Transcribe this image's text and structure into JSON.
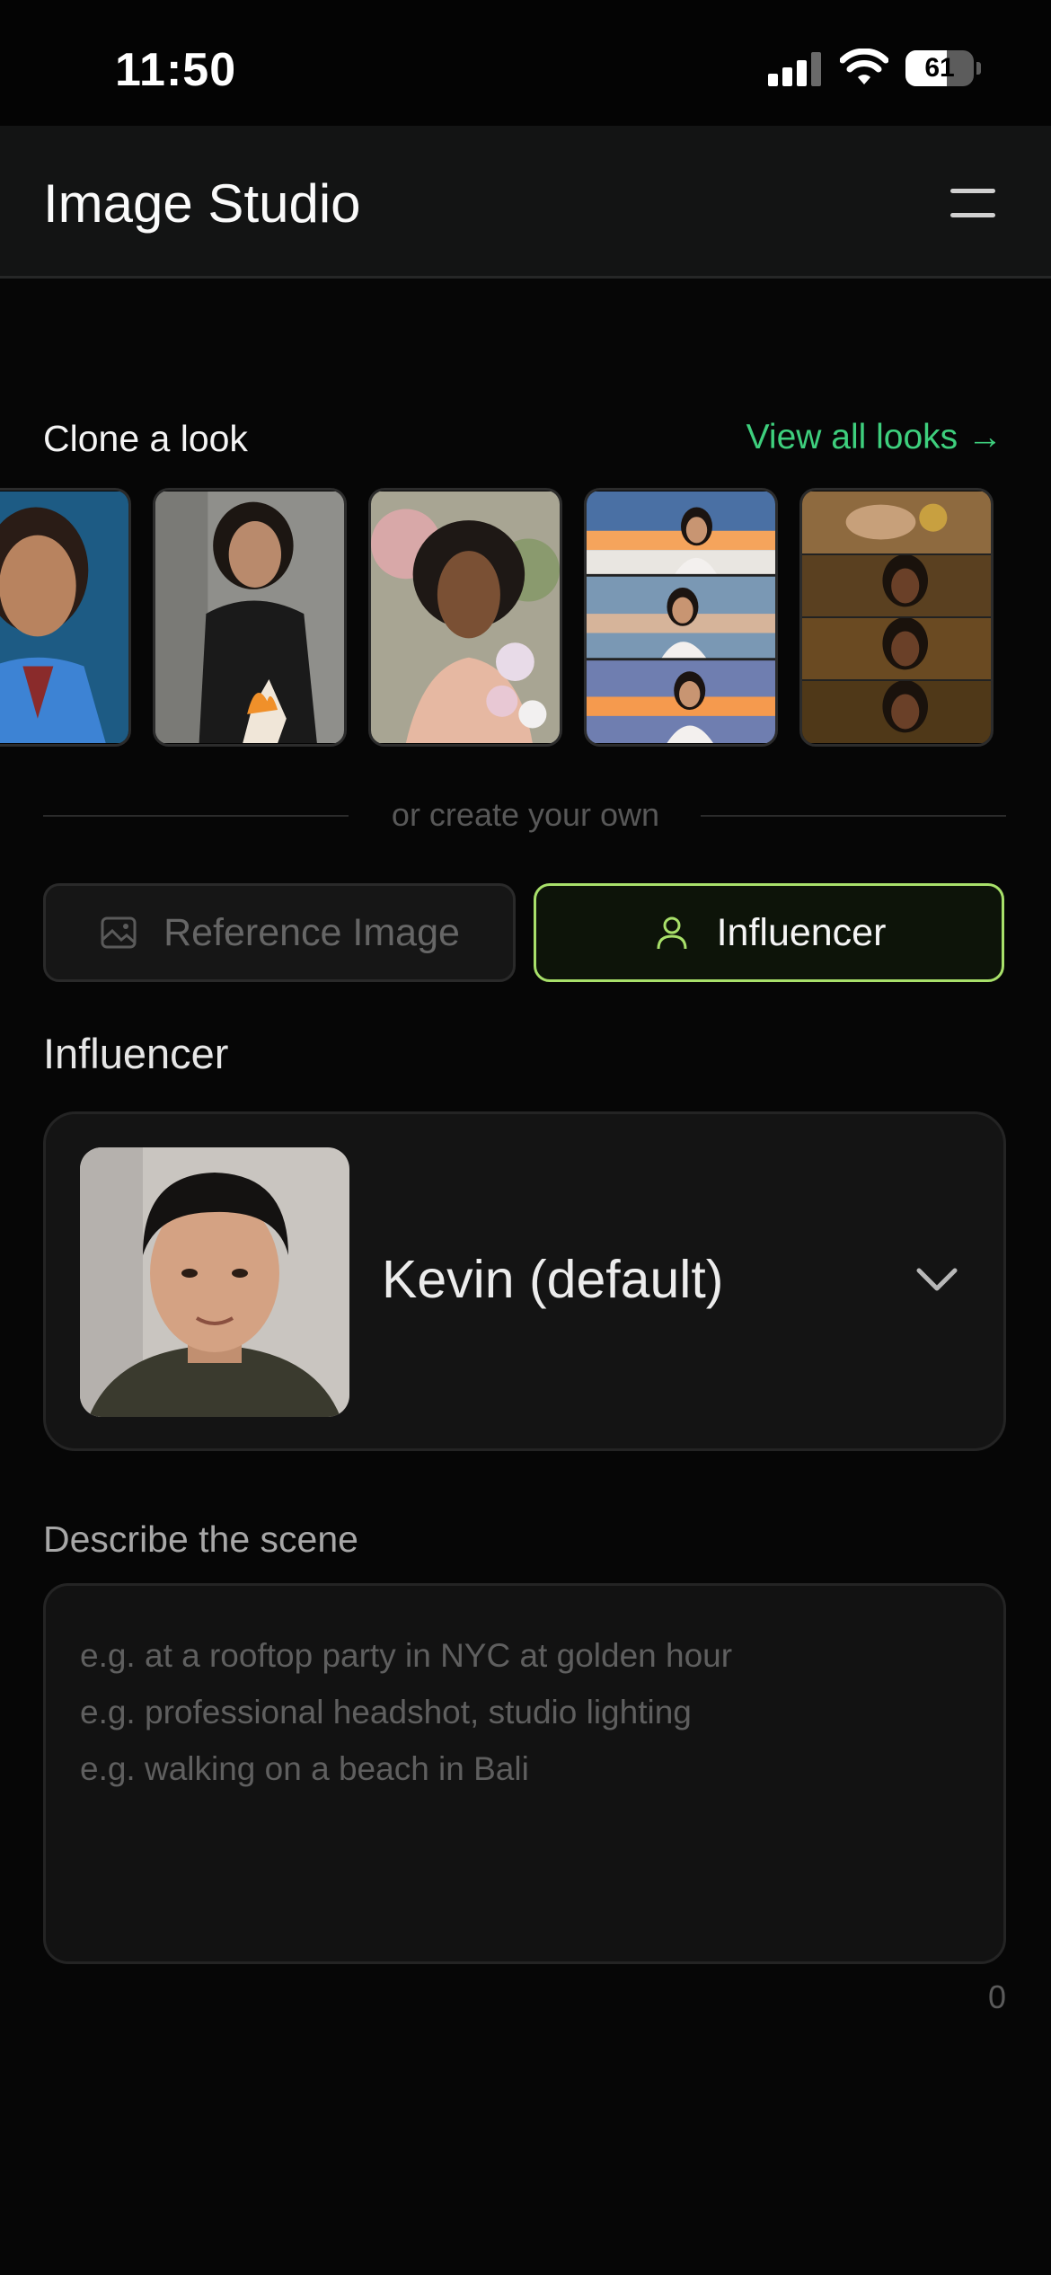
{
  "status_bar": {
    "time": "11:50",
    "battery": "61",
    "battery_level": 0.61
  },
  "header": {
    "title": "Image Studio",
    "menu_icon": "hamburger-menu-icon"
  },
  "clone_section": {
    "title": "Clone a look",
    "view_all": "View all looks →",
    "looks": [
      {
        "name": "woman-blue-shirt-portrait"
      },
      {
        "name": "woman-black-suit-burning-paper"
      },
      {
        "name": "woman-pink-flowers"
      },
      {
        "name": "woman-sparklers-beach-collage"
      },
      {
        "name": "woman-forest-golden-collage"
      }
    ]
  },
  "divider": {
    "text": "or create your own"
  },
  "tabs": {
    "reference": {
      "label": "Reference Image",
      "icon": "image-icon"
    },
    "influencer": {
      "label": "Influencer",
      "icon": "person-icon",
      "selected": true
    }
  },
  "influencer": {
    "section_label": "Influencer",
    "selected_name": "Kevin  (default)",
    "dropdown_icon": "chevron-down-icon"
  },
  "scene": {
    "label": "Describe the scene",
    "placeholder": "e.g. at a rooftop party in NYC at golden hour\ne.g. professional headshot, studio lighting\ne.g. walking on a beach in Bali",
    "char_count": "0"
  },
  "colors": {
    "accent_green": "#3ecf7d",
    "tab_border_active": "#a8e06a",
    "background": "#060606"
  }
}
